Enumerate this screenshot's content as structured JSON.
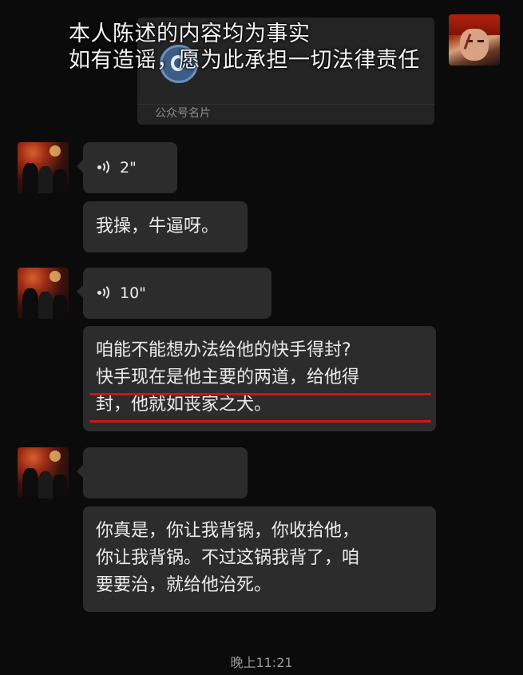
{
  "overlay": {
    "line1": "本人陈述的内容均为事实",
    "line2": "如有造谣，愿为此承担一切法律责任"
  },
  "shared_card": {
    "label": "公众号名片"
  },
  "messages": [
    {
      "type": "voice",
      "duration": "2\""
    },
    {
      "type": "text",
      "text": "我操，牛逼呀。"
    },
    {
      "type": "voice",
      "duration": "10\""
    },
    {
      "type": "text",
      "lines": [
        "咱能不能想办法给他的快手得封?",
        "快手现在是他主要的两道，给他得",
        "封，他就如丧家之犬。"
      ]
    },
    {
      "type": "blank"
    },
    {
      "type": "text",
      "lines": [
        "你真是，你让我背锅，你收拾他，",
        "你让我背锅。不过这锅我背了，咱",
        "要要治，就给他治死。"
      ]
    }
  ],
  "timestamp": "晚上11:21",
  "colors": {
    "background": "#0b0b0b",
    "bubble": "#2c2c2c",
    "highlight_underline": "#d21414"
  }
}
